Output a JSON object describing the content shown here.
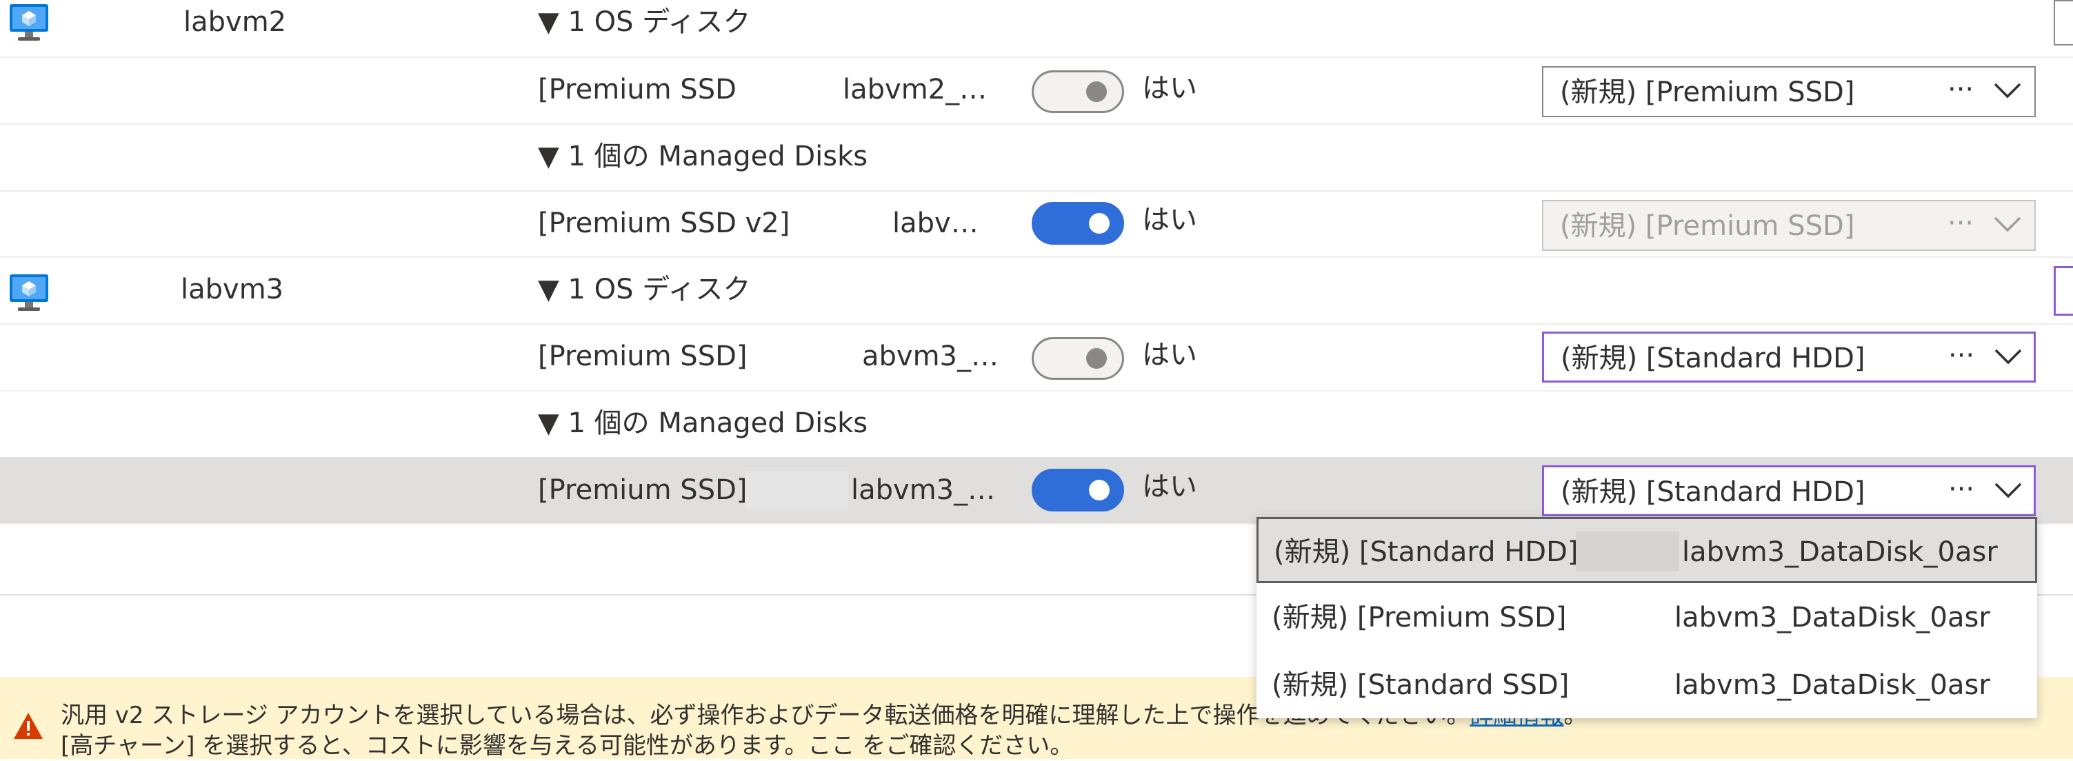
{
  "rows": {
    "vm1_name": "labvm2",
    "vm1_os_group": "▼ 1 OS ディスク",
    "vm1_os_disk_type": "[Premium SSD",
    "vm1_os_disk_name": "labvm2_…",
    "vm1_os_toggle_label": "はい",
    "vm1_os_dropdown": "(新規) [Premium SSD]",
    "vm1_managed_group": "▼ 1 個の Managed Disks",
    "vm1_data_disk_type": "[Premium SSD v2]",
    "vm1_data_disk_name": "labv…",
    "vm1_data_toggle_label": "はい",
    "vm1_data_dropdown": "(新規) [Premium SSD]",
    "vm2_name": "labvm3",
    "vm2_os_group": "▼ 1 OS ディスク",
    "vm2_os_disk_type": "[Premium SSD]",
    "vm2_os_disk_name": "abvm3_…",
    "vm2_os_toggle_label": "はい",
    "vm2_os_dropdown": "(新規) [Standard HDD]",
    "vm2_managed_group": "▼ 1 個の Managed Disks",
    "vm2_data_disk_type": "[Premium SSD]",
    "vm2_data_disk_name": "labvm3_…",
    "vm2_data_toggle_label": "はい",
    "vm2_data_dropdown": "(新規) [Standard HDD]"
  },
  "dropdown_more": "···",
  "toggles": {
    "vm1_os": false,
    "vm1_data": true,
    "vm2_os": false,
    "vm2_data": true
  },
  "menu": {
    "options": [
      {
        "tier": "(新規) [Standard HDD]",
        "name": "labvm3_DataDisk_0asr"
      },
      {
        "tier": "(新規) [Premium SSD]",
        "name": "labvm3_DataDisk_0asr"
      },
      {
        "tier": "(新規) [Standard SSD]",
        "name": "labvm3_DataDisk_0asr"
      }
    ]
  },
  "warning": {
    "text": "汎用 v2 ストレージ アカウントを選択している場合は、必ず操作およびデータ転送価格を明確に理解した上で操作を進めてください。",
    "link": "詳細情報",
    "text_end": "。",
    "line2": "[高チャーン] を選択すると、コストに影響を与える可能性があります。ここ をご確認ください。"
  },
  "icons": {
    "vm": "virtual-machine-icon",
    "warning": "warning-triangle-icon",
    "chevron": "chevron-down-icon"
  },
  "colors": {
    "toggle_on": "#2f6ed8",
    "selected_row": "#e1dfdd",
    "focus_border": "#8e5bd6",
    "link": "#0f6cbd",
    "warning_bg": "#fff4ce",
    "warning_icon": "#d83b01"
  }
}
